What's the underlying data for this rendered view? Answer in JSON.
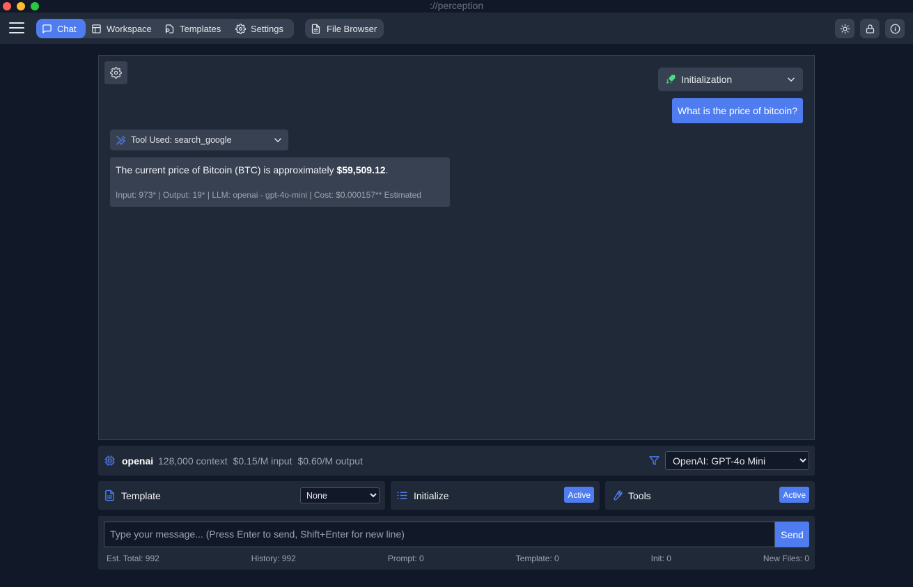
{
  "window": {
    "title": "://perception"
  },
  "nav": {
    "tabs": [
      {
        "label": "Chat",
        "icon": "chat-bubble-icon",
        "active": true
      },
      {
        "label": "Workspace",
        "icon": "layout-icon"
      },
      {
        "label": "Templates",
        "icon": "template-icon"
      },
      {
        "label": "Settings",
        "icon": "gear-icon"
      }
    ],
    "file_browser": "File Browser",
    "right_icons": [
      "sun-icon",
      "lock-icon",
      "info-icon"
    ]
  },
  "chat": {
    "init_dropdown": "Initialization",
    "user_message": "What is the price of bitcoin?",
    "tool_used": "Tool Used: search_google",
    "assistant": {
      "text_prefix": "The current price of Bitcoin (BTC) is approximately ",
      "text_bold": "$59,509.12",
      "text_suffix": ".",
      "meta": "Input: 973* | Output: 19* | LLM: openai - gpt-4o-mini | Cost: $0.000157** Estimated"
    }
  },
  "model": {
    "provider": "openai",
    "context": "128,000 context",
    "input_price": "$0.15/M input",
    "output_price": "$0.60/M output",
    "selected": "OpenAI: GPT-4o Mini"
  },
  "controls": {
    "template_label": "Template",
    "template_value": "None",
    "initialize_label": "Initialize",
    "initialize_badge": "Active",
    "tools_label": "Tools",
    "tools_badge": "Active"
  },
  "input": {
    "placeholder": "Type your message... (Press Enter to send, Shift+Enter for new line)",
    "send_label": "Send"
  },
  "stats": {
    "est_total": "Est. Total: 992",
    "history": "History: 992",
    "prompt": "Prompt: 0",
    "template": "Template: 0",
    "init": "Init: 0",
    "new_files": "New Files: 0"
  },
  "colors": {
    "accent": "#4f7df0",
    "background": "#111827",
    "panel": "#1f2937",
    "element": "#374151"
  }
}
